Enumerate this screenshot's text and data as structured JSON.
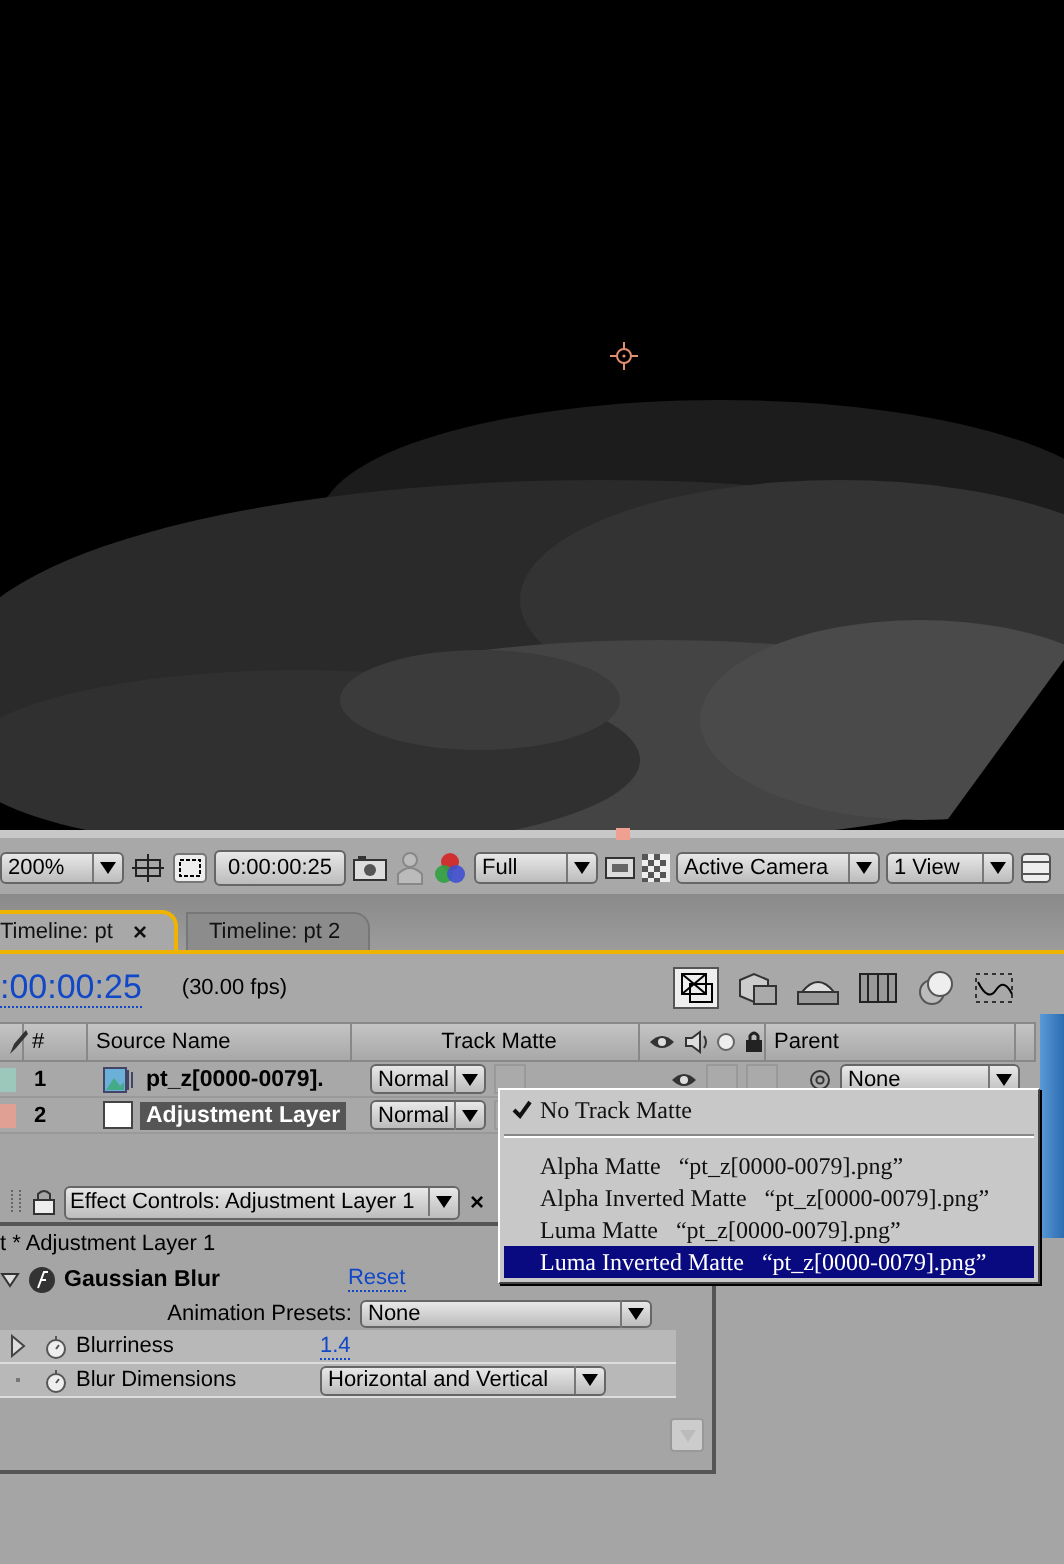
{
  "viewer_toolbar": {
    "zoom": "200%",
    "timecode": "0:00:00:25",
    "resolution": "Full",
    "camera": "Active Camera",
    "layout": "1 View"
  },
  "tabs": [
    {
      "label": "Timeline: pt",
      "selected": true,
      "close": "×"
    },
    {
      "label": "Timeline: pt 2",
      "selected": false
    }
  ],
  "timeline": {
    "timecode": ":00:00:25",
    "fps": "(30.00 fps)",
    "columns": [
      "#",
      "Source Name",
      "Track Matte",
      "Parent"
    ],
    "layers": [
      {
        "number": "1",
        "color": "#9cc8bc",
        "kind": "footage",
        "name": "pt_z[0000-0079].",
        "mode": "Normal",
        "video_on": true,
        "parent": "None",
        "selected": false
      },
      {
        "number": "2",
        "color": "#e0a094",
        "kind": "adjustment",
        "name": "Adjustment Layer",
        "mode": "Normal",
        "selected": true
      }
    ]
  },
  "track_matte_menu": {
    "sections": [
      [
        {
          "label": "No Track Matte",
          "checked": true,
          "selected": false
        }
      ],
      [
        {
          "label": "Alpha Matte",
          "source": "“pt_z[0000-0079].png”",
          "checked": false,
          "selected": false
        },
        {
          "label": "Alpha Inverted Matte",
          "source": "“pt_z[0000-0079].png”",
          "checked": false,
          "selected": false
        },
        {
          "label": "Luma Matte",
          "source": "“pt_z[0000-0079].png”",
          "checked": false,
          "selected": false
        },
        {
          "label": "Luma Inverted Matte",
          "source": "“pt_z[0000-0079].png”",
          "checked": false,
          "selected": true
        }
      ]
    ]
  },
  "effect_controls": {
    "tab": "Effect Controls: Adjustment Layer 1",
    "close": "×",
    "subtitle": "t * Adjustment Layer 1",
    "effect": {
      "name": "Gaussian Blur",
      "expanded": true,
      "reset": "Reset"
    },
    "presets": {
      "label": "Animation Presets:",
      "value": "None"
    },
    "properties": [
      {
        "kind": "value",
        "name": "Blurriness",
        "value": "1.4"
      },
      {
        "kind": "dropdown",
        "name": "Blur Dimensions",
        "value": "Horizontal and Vertical"
      }
    ]
  }
}
